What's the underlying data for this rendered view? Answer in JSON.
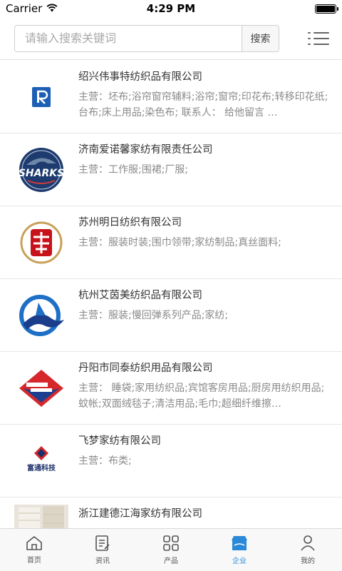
{
  "status": {
    "carrier": "Carrier",
    "time": "4:29 PM",
    "battery_level": 1.0
  },
  "search": {
    "placeholder": "请输入搜索关键词",
    "button_label": "搜索"
  },
  "companies": [
    {
      "name": "绍兴伟事特纺织品有限公司",
      "desc": "主营：坯布;浴帘窗帘辅料;浴帘;窗帘;印花布;转移印花纸;台布;床上用品;染色布; 联系人： 给他留言 …",
      "logo": "r-square-logo"
    },
    {
      "name": "济南爱诺馨家纺有限责任公司",
      "desc": "主营：工作服;围裙;厂服;",
      "logo": "sharks-logo",
      "logo_text": "SHARKS"
    },
    {
      "name": "苏州明日纺织有限公司",
      "desc": "主营：服装时装;围巾领带;家纺制品;真丝面料;",
      "logo": "red-seal-logo"
    },
    {
      "name": "杭州艾茵美纺织品有限公司",
      "desc": "主营：服装;慢回弹系列产品;家纺;",
      "logo": "blue-wave-logo"
    },
    {
      "name": "丹阳市同泰纺织用品有限公司",
      "desc": "主营： 睡袋;家用纺织品;宾馆客房用品;厨房用纺织用品;蚊帐;双面绒毯子;清洁用品;毛巾;超细纤维擦…",
      "logo": "red-blue-diamond-logo"
    },
    {
      "name": "飞梦家纺有限公司",
      "desc": "主营：布类;",
      "logo": "feimeng-logo",
      "logo_text": "富通科技"
    },
    {
      "name": "浙江建德江海家纺有限公司",
      "desc": "",
      "logo": "fabric-photo"
    }
  ],
  "tabs": [
    {
      "label": "首页",
      "icon": "home-icon",
      "active": false
    },
    {
      "label": "资讯",
      "icon": "news-icon",
      "active": false
    },
    {
      "label": "产品",
      "icon": "grid-icon",
      "active": false
    },
    {
      "label": "企业",
      "icon": "store-icon",
      "active": true
    },
    {
      "label": "我的",
      "icon": "person-icon",
      "active": false
    }
  ],
  "colors": {
    "accent": "#2a8ad8",
    "divider": "#e6e6e6",
    "text_secondary": "#8a8a8a"
  }
}
